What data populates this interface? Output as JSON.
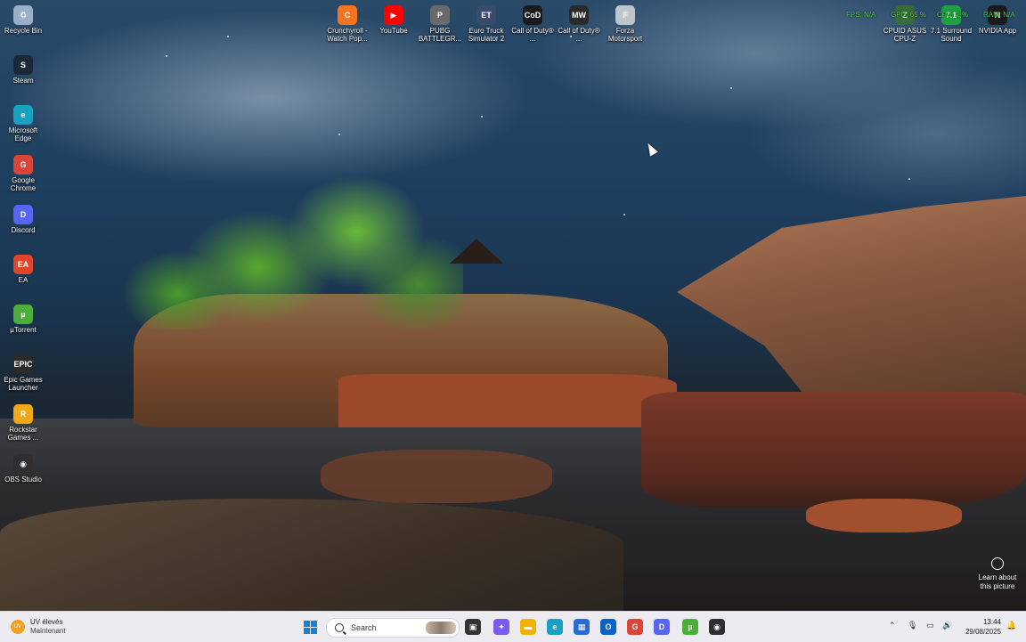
{
  "desktop_icons_left": [
    {
      "label": "Recycle Bin",
      "icon": "recycle-bin-icon",
      "color": "#9ab0c8",
      "glyph": "♻"
    },
    {
      "label": "Steam",
      "icon": "steam-icon",
      "color": "#1b2838",
      "glyph": "S"
    },
    {
      "label": "Microsoft Edge",
      "icon": "edge-icon",
      "color": "#1aa0c0",
      "glyph": "e"
    },
    {
      "label": "Google Chrome",
      "icon": "chrome-icon",
      "color": "#db4437",
      "glyph": "G"
    },
    {
      "label": "Discord",
      "icon": "discord-icon",
      "color": "#5865f2",
      "glyph": "D"
    },
    {
      "label": "EA",
      "icon": "ea-icon",
      "color": "#e0442a",
      "glyph": "EA"
    },
    {
      "label": "µTorrent",
      "icon": "utorrent-icon",
      "color": "#4caf3a",
      "glyph": "µ"
    },
    {
      "label": "Epic Games Launcher",
      "icon": "epic-games-icon",
      "color": "#2a2a2a",
      "glyph": "EPIC"
    },
    {
      "label": "Rockstar Games ...",
      "icon": "rockstar-icon",
      "color": "#f0a818",
      "glyph": "R"
    },
    {
      "label": "OBS Studio",
      "icon": "obs-icon",
      "color": "#302e31",
      "glyph": "◉"
    }
  ],
  "desktop_icons_top": [
    {
      "label": "Crunchyroll - Watch Pop...",
      "icon": "crunchyroll-icon",
      "color": "#f47521",
      "glyph": "C"
    },
    {
      "label": "YouTube",
      "icon": "youtube-icon",
      "color": "#ff0000",
      "glyph": "▶"
    },
    {
      "label": "PUBG BATTLEGR...",
      "icon": "pubg-icon",
      "color": "#6a6a6a",
      "glyph": "P"
    },
    {
      "label": "Euro Truck Simulator 2",
      "icon": "euro-truck-icon",
      "color": "#3a4a6a",
      "glyph": "ET"
    },
    {
      "label": "Call of Duty® ...",
      "icon": "call-of-duty-icon",
      "color": "#1a1a1a",
      "glyph": "CoD"
    },
    {
      "label": "Call of Duty® ...",
      "icon": "call-of-duty-mw-icon",
      "color": "#2a2a2a",
      "glyph": "MW"
    },
    {
      "label": "Forza Motorsport",
      "icon": "forza-icon",
      "color": "#c0c4cc",
      "glyph": "F"
    }
  ],
  "desktop_icons_right": [
    {
      "label": "CPUID ASUS CPU-Z",
      "icon": "cpuz-icon",
      "color": "#3a6a3a",
      "glyph": "Z"
    },
    {
      "label": "7.1 Surround Sound",
      "icon": "surround-sound-icon",
      "color": "#20a040",
      "glyph": "7.1"
    },
    {
      "label": "NVIDIA App",
      "icon": "nvidia-icon",
      "color": "#1a1a1a",
      "glyph": "N"
    }
  ],
  "overlay": {
    "fps": "FPS: N/A",
    "gpu": "GPU: 65 %",
    "cpu": "CPU: 2 %",
    "ram": "RAM: N/A"
  },
  "spotlight": {
    "label": "Learn about this picture"
  },
  "taskbar": {
    "weather_title": "UV élevés",
    "weather_sub": "Maintenant",
    "weather_glyph": "UV",
    "search_placeholder": "Search",
    "pinned": [
      {
        "name": "task-view-icon",
        "color": "#333",
        "glyph": "▣"
      },
      {
        "name": "copilot-icon",
        "color": "#7a5af0",
        "glyph": "✦"
      },
      {
        "name": "file-explorer-icon",
        "color": "#f0b400",
        "glyph": "▬"
      },
      {
        "name": "edge-taskbar-icon",
        "color": "#1aa0c0",
        "glyph": "e"
      },
      {
        "name": "store-icon",
        "color": "#2a6ad8",
        "glyph": "▦"
      },
      {
        "name": "outlook-icon",
        "color": "#0a64c8",
        "glyph": "O"
      },
      {
        "name": "chrome-taskbar-icon",
        "color": "#db4437",
        "glyph": "G"
      },
      {
        "name": "discord-taskbar-icon",
        "color": "#5865f2",
        "glyph": "D"
      },
      {
        "name": "utorrent-taskbar-icon",
        "color": "#4caf3a",
        "glyph": "µ"
      },
      {
        "name": "obs-taskbar-icon",
        "color": "#302e31",
        "glyph": "◉"
      }
    ],
    "time": "13:44",
    "date": "29/08/2025"
  }
}
